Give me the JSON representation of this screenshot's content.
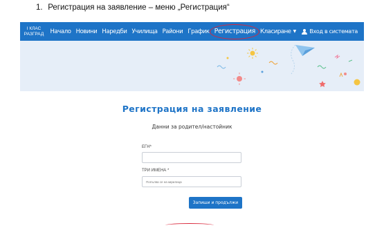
{
  "document": {
    "step_number": "1.",
    "heading": "Регистрация на заявление – меню „Регистрация“"
  },
  "navbar": {
    "brand_line1": "I КЛАС",
    "brand_line2": "РАЗГРАД",
    "items": [
      {
        "label": "Начало"
      },
      {
        "label": "Новини"
      },
      {
        "label": "Наредби"
      },
      {
        "label": "Училища"
      },
      {
        "label": "Райони"
      },
      {
        "label": "График"
      },
      {
        "label": "Регистрация",
        "active": true
      },
      {
        "label": "Класиране",
        "dropdown": true
      }
    ],
    "login_label": "Вход в системата",
    "accent_color": "#1e74c7",
    "highlight_color": "#d9263a"
  },
  "form": {
    "title": "Регистрация на заявление",
    "section_title": "Данни за родител/настойник",
    "egn_label": "ЕГН*",
    "egn_value": "",
    "names_label": "ТРИ ИМЕНА *",
    "names_placeholder": "Попълва се на кирилица",
    "submit_label": "Запиши и продължи"
  }
}
